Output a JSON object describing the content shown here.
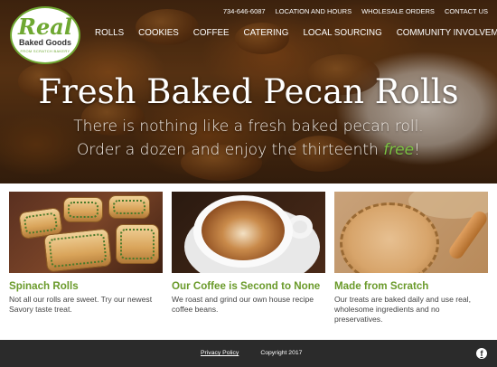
{
  "brand": {
    "logo_word": "Real",
    "logo_sub": "Baked Goods",
    "logo_tag": "FROM SCRATCH BAKERY"
  },
  "utility_nav": [
    {
      "label": "734-646-6087"
    },
    {
      "label": "LOCATION AND HOURS"
    },
    {
      "label": "WHOLESALE ORDERS"
    },
    {
      "label": "CONTACT US"
    }
  ],
  "main_nav": [
    {
      "label": "ROLLS"
    },
    {
      "label": "COOKIES"
    },
    {
      "label": "COFFEE"
    },
    {
      "label": "CATERING"
    },
    {
      "label": "LOCAL SOURCING"
    },
    {
      "label": "COMMUNITY INVOLVEMENT"
    }
  ],
  "hero": {
    "title": "Fresh Baked Pecan Rolls",
    "line1": "There is nothing like a fresh baked pecan roll.",
    "line2_prefix": "Order a dozen and enjoy the thirteenth ",
    "line2_highlight": "free",
    "line2_suffix": "!"
  },
  "cards": [
    {
      "title": "Spinach Rolls",
      "text": "Not all our rolls are sweet. Try our newest Savory taste treat."
    },
    {
      "title": "Our Coffee is Second to None",
      "text": "We roast and grind our own house recipe coffee beans."
    },
    {
      "title": "Made from Scratch",
      "text": "Our treats are baked daily and use real, wholesome ingredients and no preservatives."
    }
  ],
  "footer": {
    "privacy": "Privacy Policy",
    "copyright": "Copyright 2017",
    "social_icon": "facebook-icon",
    "social_glyph": "f"
  },
  "colors": {
    "brand_green": "#6a9a2a",
    "footer_bg": "#2b2b2b"
  }
}
